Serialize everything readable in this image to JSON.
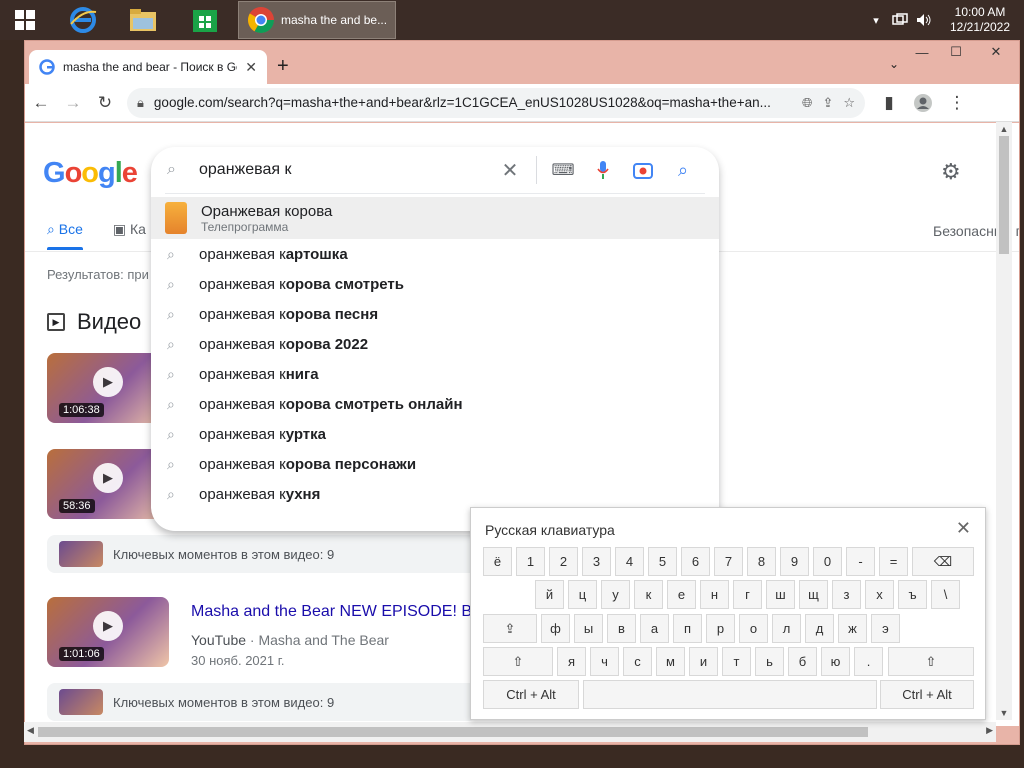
{
  "taskbar": {
    "chrome_task_label": "masha the and be...",
    "time": "10:00 AM",
    "date": "12/21/2022"
  },
  "browser": {
    "tab_title": "masha the and bear - Поиск в Google",
    "url": "google.com/search?q=masha+the+and+bear&rlz=1C1GCEA_enUS1028US1028&oq=masha+the+an..."
  },
  "page": {
    "logo": "Google",
    "search_value": "оранжевая к",
    "tab_all": "Все",
    "tab_images": "Ка",
    "safe_search": "Безопасный поиск",
    "results_count": "Результатов: при",
    "videos_heading": "Видео",
    "video1_duration": "1:06:38",
    "video2_duration": "58:36",
    "video3_duration": "1:01:06",
    "key_moments": "Ключевых моментов в этом видео: 9",
    "result_title": "Masha and the Bear NEW EPISODE! B",
    "result_source": "YouTube",
    "result_channel": "· Masha and The Bear",
    "result_date": "30 нояб. 2021 г."
  },
  "suggestions": {
    "first_title": "Оранжевая корова",
    "first_subtitle": "Телепрограмма",
    "prefix": "оранжевая к",
    "items": [
      "артошка",
      "орова смотреть",
      "орова песня",
      "орова 2022",
      "нига",
      "орова смотреть онлайн",
      "уртка",
      "орова персонажи",
      "ухня"
    ]
  },
  "keyboard": {
    "title": "Русская клавиатура",
    "row1": [
      "ё",
      "1",
      "2",
      "3",
      "4",
      "5",
      "6",
      "7",
      "8",
      "9",
      "0",
      "-",
      "="
    ],
    "row2": [
      "й",
      "ц",
      "у",
      "к",
      "е",
      "н",
      "г",
      "ш",
      "щ",
      "з",
      "х",
      "ъ",
      "\\"
    ],
    "row3": [
      "ф",
      "ы",
      "в",
      "а",
      "п",
      "р",
      "о",
      "л",
      "д",
      "ж",
      "э"
    ],
    "row4": [
      "я",
      "ч",
      "с",
      "м",
      "и",
      "т",
      "ь",
      "б",
      "ю",
      "."
    ],
    "ctrl_alt": "Ctrl + Alt"
  }
}
